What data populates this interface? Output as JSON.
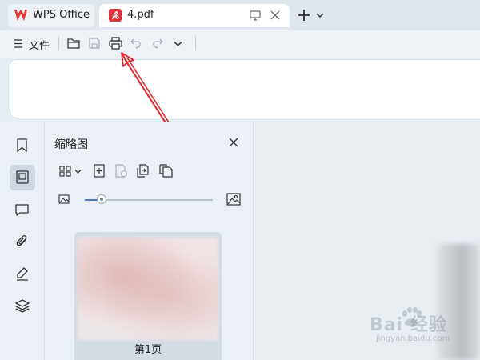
{
  "tabs": {
    "wps_label": "WPS Office",
    "pdf_label": "4.pdf"
  },
  "toolbar": {
    "menu_label": "文件"
  },
  "thumbnail_panel": {
    "title": "缩略图",
    "zoom_level": 0.13,
    "pages": [
      {
        "label": "第1页"
      }
    ]
  },
  "watermark": {
    "brand": "Bai  经验",
    "sub": "jingyan.baidu.com"
  },
  "colors": {
    "wps_red": "#e5332b",
    "pdf_red": "#e0303a",
    "annotation_arrow": "#e0242b",
    "slider_accent": "#4a7cc5"
  }
}
